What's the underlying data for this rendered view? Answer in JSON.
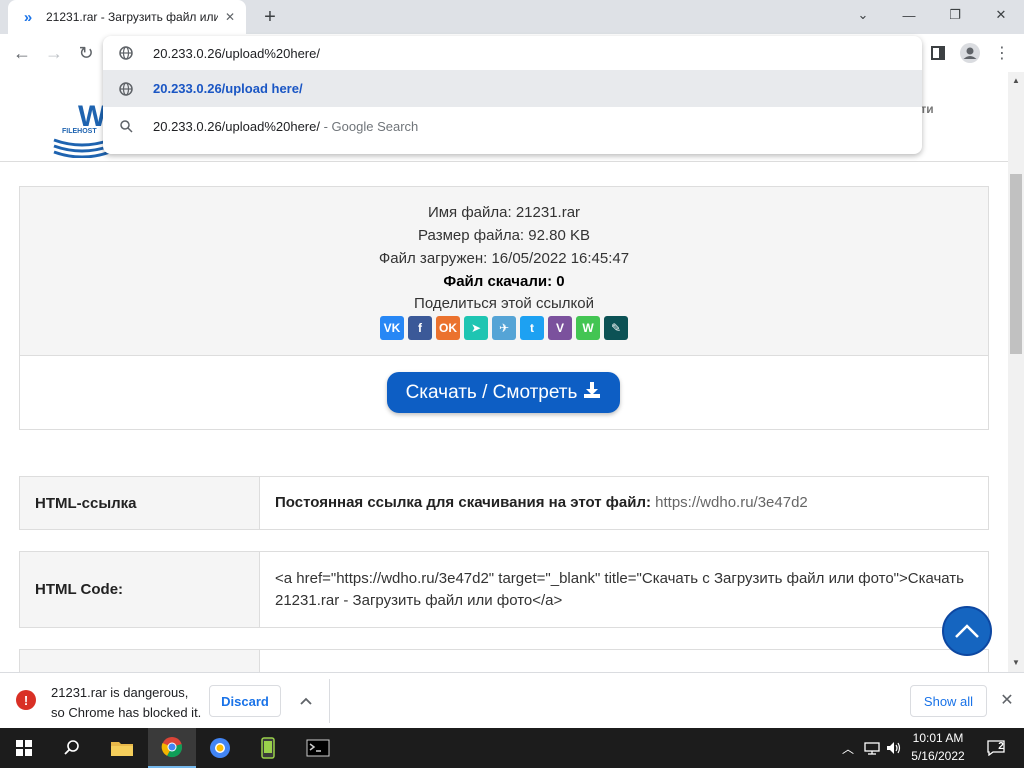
{
  "browser": {
    "tab_title": "21231.rar - Загрузить файл или",
    "new_tab_icon": "plus-icon",
    "omnibox": {
      "input_value": "20.233.0.26/upload%20here/",
      "suggestions": [
        {
          "text": "20.233.0.26/upload here/",
          "icon": "globe-icon"
        },
        {
          "text": "20.233.0.26/upload%20here/",
          "sub": " - Google Search",
          "icon": "search-icon"
        }
      ]
    }
  },
  "site": {
    "header_link": "йти"
  },
  "file": {
    "name_line": "Имя файла: 21231.rar",
    "size_line": "Размер файла: 92.80 KB",
    "uploaded_line": "Файл загружен: 16/05/2022 16:45:47",
    "downloads_label": "Файл скачали:",
    "downloads_value": "0",
    "share_label": "Поделиться этой ссылкой",
    "share_buttons": [
      {
        "label": "VK",
        "color": "#2787f5"
      },
      {
        "label": "f",
        "color": "#3b5998"
      },
      {
        "label": "OK",
        "color": "#eb722e"
      },
      {
        "label": "➤",
        "color": "#1ec5b2"
      },
      {
        "label": "✈",
        "color": "#55a4d6"
      },
      {
        "label": "t",
        "color": "#1da1f2"
      },
      {
        "label": "V",
        "color": "#7b519d"
      },
      {
        "label": "W",
        "color": "#43c553"
      },
      {
        "label": "✎",
        "color": "#0c5255"
      }
    ],
    "download_button": "Скачать / Смотреть"
  },
  "links": {
    "html_link_label": "HTML-ссылка",
    "html_link_desc": "Постоянная ссылка для скачивания на этот файл:",
    "html_link_url": "https://wdho.ru/3e47d2",
    "html_code_label": "HTML Code:",
    "html_code_value": "<a href=\"https://wdho.ru/3e47d2\" target=\"_blank\" title=\"Скачать с Загрузить файл или фото\">Скачать 21231.rar - Загрузить файл или фото</a>"
  },
  "download_shelf": {
    "warning_line1": "21231.rar is dangerous,",
    "warning_line2": "so Chrome has blocked it.",
    "discard": "Discard",
    "show_all": "Show all"
  },
  "taskbar": {
    "time": "10:01 AM",
    "date": "5/16/2022",
    "notification_count": "2"
  },
  "colors": {
    "accent": "#0d5ec4",
    "link": "#1a56c4",
    "danger": "#d93025"
  }
}
